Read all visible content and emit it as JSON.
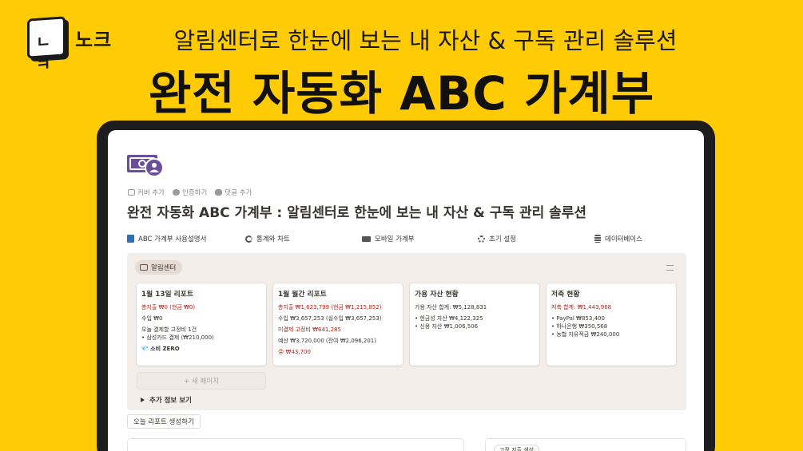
{
  "brand": {
    "logo_mark": "ㄴㅋ",
    "name": "노크"
  },
  "headline": {
    "subtitle": "알림센터로 한눈에 보는 내 자산 & 구독 관리 솔루션",
    "title": "완전 자동화 ABC 가계부"
  },
  "page": {
    "actions": {
      "add_cover": "커버 추가",
      "verify": "인증하기",
      "add_comment": "댓글 추가"
    },
    "title": "완전 자동화 ABC 가계부 : 알림센터로 한눈에 보는 내 자산 & 구독 관리 솔루션"
  },
  "nav": [
    {
      "label": "ABC 가계부 사용설명서",
      "icon": "book-icon"
    },
    {
      "label": "통계와 차트",
      "icon": "pie-chart-icon"
    },
    {
      "label": "모바일 가계부",
      "icon": "battery-icon"
    },
    {
      "label": "초기 설정",
      "icon": "gear-icon"
    },
    {
      "label": "데이터베이스",
      "icon": "database-icon"
    }
  ],
  "alert_center": {
    "tag": "알림센터",
    "cards": [
      {
        "title": "1월 13일 리포트",
        "lines": [
          "총지출 ₩0 (현금 ₩0)",
          "수입 ₩0",
          "오늘 결제할 고정비 1건",
          "• 삼성카드 결제 (₩210,000)",
          "💎 소비 ZERO"
        ]
      },
      {
        "title": "1월 월간 리포트",
        "lines": [
          "총지출 ₩1,623,799 (현금 ₩1,215,852)",
          "수입 ₩3,657,253 (실수입 ₩3,657,253)",
          "미결제 고정비 ₩641,285",
          "예산 ₩3,720,000 (잔여 ₩2,096,201)",
          "😡 ₩43,700"
        ]
      },
      {
        "title": "가용 자산 현황",
        "lines": [
          "가용 자산 합계: ₩5,128,831",
          "• 현금성 자산 ₩4,122,325",
          "• 신용 자산 ₩1,006,506"
        ]
      },
      {
        "title": "저축 현황",
        "lines": [
          "저축 합계: ₩1,443,968",
          "• PayPal ₩853,400",
          "• 하나은행 ₩350,568",
          "• 농협 자유적금 ₩240,000"
        ]
      }
    ],
    "new_page": "+ 새 페이지",
    "more_info": "추가 정보 보기"
  },
  "report_button": "오늘 리포트 생성하기",
  "bottom_chip": "고정 지출 생성",
  "colors": {
    "background": "#FFCB05",
    "device": "#1D1D1F",
    "callout": "#F4EEEA",
    "alert_red": "#B42318",
    "icon_purple": "#6B4E9B"
  }
}
